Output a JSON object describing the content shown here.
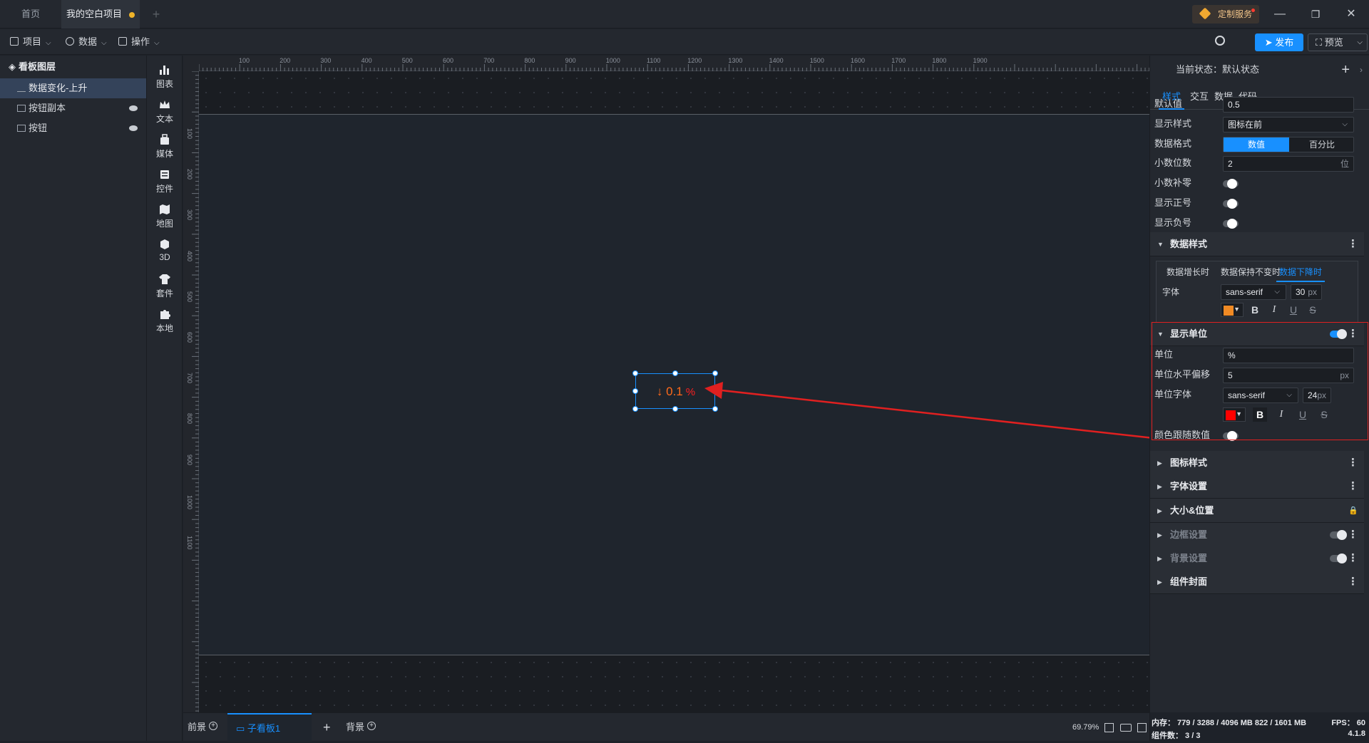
{
  "tabs": [
    {
      "label": "首页",
      "active": false
    },
    {
      "label": "我的空白项目",
      "active": true,
      "modified": true
    }
  ],
  "custom_service": "定制服务",
  "toolbar": {
    "menus": [
      {
        "label": "项目",
        "icon": "document-icon"
      },
      {
        "label": "数据",
        "icon": "database-icon"
      },
      {
        "label": "操作",
        "icon": "grid-icon"
      }
    ],
    "publish": "发布",
    "preview": "预览"
  },
  "layers": {
    "title": "看板图层",
    "items": [
      {
        "label": "数据变化-上升",
        "selected": true,
        "icon": "chart-icon"
      },
      {
        "label": "按钮副本",
        "selected": false,
        "icon": "image-icon",
        "hidden": true
      },
      {
        "label": "按钮",
        "selected": false,
        "icon": "image-icon",
        "hidden": true
      }
    ]
  },
  "components": [
    {
      "label": "图表",
      "icon": "bar-chart-icon"
    },
    {
      "label": "文本",
      "icon": "crown-icon"
    },
    {
      "label": "媒体",
      "icon": "media-icon"
    },
    {
      "label": "控件",
      "icon": "controls-icon"
    },
    {
      "label": "地图",
      "icon": "map-icon"
    },
    {
      "label": "3D",
      "icon": "cube-icon"
    },
    {
      "label": "套件",
      "icon": "shirt-icon"
    },
    {
      "label": "本地",
      "icon": "puzzle-icon"
    }
  ],
  "ruler": {
    "top_labels": [
      "100",
      "200",
      "300",
      "400",
      "500",
      "600",
      "700",
      "800",
      "900",
      "1000",
      "1100",
      "1200",
      "1300",
      "1400",
      "1500",
      "1600",
      "1700",
      "1800",
      "1900"
    ],
    "left_labels": [
      "100",
      "200",
      "300",
      "400",
      "500",
      "600",
      "700",
      "800",
      "900",
      "1000",
      "1100"
    ]
  },
  "widget": {
    "arrow": "↓",
    "value": "0.1",
    "unit": "%"
  },
  "bottom": {
    "foreground": "前景",
    "sub_board": "子看板1",
    "background": "背景",
    "zoom": "69.79%"
  },
  "panel": {
    "state_label": "当前状态：",
    "state_value": "默认状态",
    "tabs": [
      "样式",
      "交互",
      "数据",
      "代码"
    ],
    "active_tab": "样式",
    "default_value_label": "默认值",
    "default_value": "0.5",
    "display_style_label": "显示样式",
    "display_style_value": "图标在前",
    "data_format_label": "数据格式",
    "data_format_options": [
      "数值",
      "百分比"
    ],
    "decimals_label": "小数位数",
    "decimals_value": "2",
    "decimals_unit": "位",
    "pad_zero_label": "小数补零",
    "show_plus_label": "显示正号",
    "show_minus_label": "显示负号",
    "data_style_section": "数据样式",
    "data_style_tabs": [
      "数据增长时",
      "数据保持不变时",
      "数据下降时"
    ],
    "font_label": "字体",
    "font_value": "sans-serif",
    "font_size": "30",
    "px": "px",
    "font_color": "#f08a24",
    "show_unit_section": "显示单位",
    "unit_label": "单位",
    "unit_value": "%",
    "unit_offset_label": "单位水平偏移",
    "unit_offset_value": "5",
    "unit_font_label": "单位字体",
    "unit_font_value": "sans-serif",
    "unit_font_size": "24",
    "unit_color": "#ff0000",
    "color_follow_label": "颜色跟随数值",
    "sections": [
      {
        "label": "图标样式",
        "dim": false,
        "kind": "more"
      },
      {
        "label": "字体设置",
        "dim": false,
        "kind": "more"
      },
      {
        "label": "大小&位置",
        "dim": false,
        "kind": "lock"
      },
      {
        "label": "边框设置",
        "dim": true,
        "kind": "toggle"
      },
      {
        "label": "背景设置",
        "dim": true,
        "kind": "toggle"
      },
      {
        "label": "组件封面",
        "dim": false,
        "kind": "more"
      }
    ],
    "status": {
      "memory": "内存： 779 / 3288 / 4096 MB  822 / 1601 MB",
      "fps": "FPS： 60",
      "components": "组件数： 3 / 3",
      "version": "4.1.8"
    }
  },
  "colors": {
    "accent": "#1890ff",
    "highlight_red": "#e02020",
    "value_orange": "#ff6a1a"
  }
}
